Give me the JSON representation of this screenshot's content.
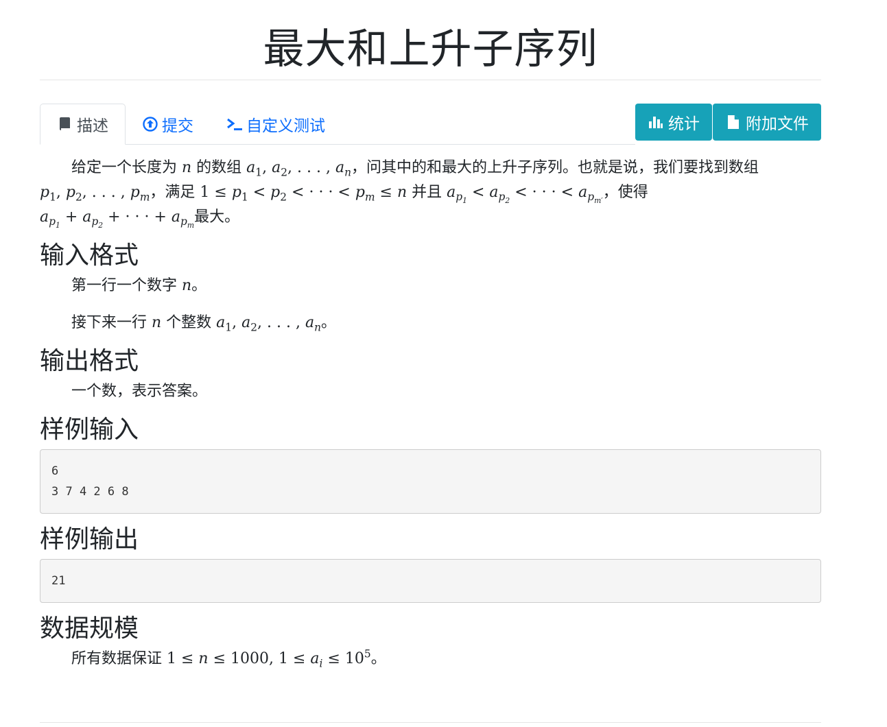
{
  "page": {
    "title": "最大和上升子序列"
  },
  "tabs": [
    {
      "label": "描述",
      "icon": "book-icon",
      "active": true
    },
    {
      "label": "提交",
      "icon": "upload-circle-icon",
      "active": false
    },
    {
      "label": "自定义测试",
      "icon": "terminal-icon",
      "active": false
    }
  ],
  "buttons": {
    "stats_label": "统计",
    "attachments_label": "附加文件"
  },
  "description": {
    "l1_a": "给定一个长度为 ",
    "l1_b": " 的数组 ",
    "l1_c": "，问其中的和最大的上升子序列。也就是说，我们要找到数组",
    "l2_a": "，满足 ",
    "l2_b": " 并且 ",
    "l2_c": "，使得",
    "l3_a": "最大。"
  },
  "sections": {
    "input_format": "输入格式",
    "output_format": "输出格式",
    "sample_input": "样例输入",
    "sample_output": "样例输出",
    "data_range": "数据规模"
  },
  "input_format": {
    "line1_a": "第一行一个数字 ",
    "line1_b": "。",
    "line2_a": "接下来一行 ",
    "line2_b": " 个整数 ",
    "line2_c": "。"
  },
  "output_format": {
    "text": "一个数，表示答案。"
  },
  "samples": {
    "input": "6\n3 7 4 2 6 8",
    "output": "21"
  },
  "data_range": {
    "a": "所有数据保证 ",
    "b": "。"
  },
  "colors": {
    "link": "#0d6efd",
    "button_bg": "#17a2b8",
    "sample_bg": "#f5f5f5"
  }
}
